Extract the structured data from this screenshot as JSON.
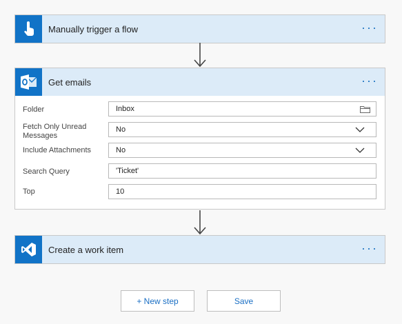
{
  "trigger": {
    "title": "Manually trigger a flow",
    "icon": "touch-hand-icon",
    "more": "···"
  },
  "get_emails": {
    "title": "Get emails",
    "icon": "outlook-icon",
    "more": "···",
    "fields": [
      {
        "label": "Folder",
        "value": "Inbox",
        "control": "folder-picker"
      },
      {
        "label": "Fetch Only Unread Messages",
        "value": "No",
        "control": "dropdown"
      },
      {
        "label": "Include Attachments",
        "value": "No",
        "control": "dropdown"
      },
      {
        "label": "Search Query",
        "value": "'Ticket'",
        "control": "text"
      },
      {
        "label": "Top",
        "value": "10",
        "control": "text"
      }
    ]
  },
  "work_item": {
    "title": "Create a work item",
    "icon": "visual-studio-icon",
    "more": "···"
  },
  "buttons": {
    "new_step": "+ New step",
    "save": "Save"
  },
  "colors": {
    "accent": "#1173c7",
    "header_bg": "#dcebf8",
    "link": "#1c73c2"
  }
}
